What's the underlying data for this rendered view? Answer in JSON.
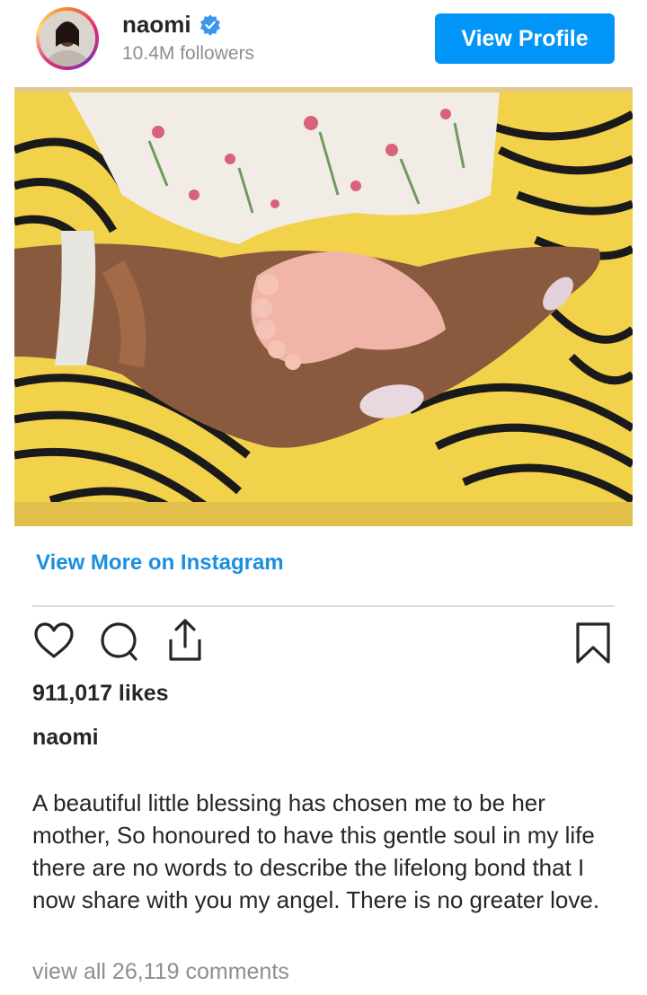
{
  "header": {
    "username": "naomi",
    "followers": "10.4M followers",
    "view_profile_label": "View Profile"
  },
  "post": {
    "image_alt": "Baby feet cradled in a hand over yellow and black patterned fabric",
    "view_more_label": "View More on Instagram",
    "likes": "911,017 likes",
    "author": "naomi",
    "caption": "A beautiful little blessing has chosen me to be her mother, So honoured to have this gentle soul in my life there are no words to describe the lifelong bond that I now share with you my angel. There is no greater love.",
    "comments_link": "view all 26,119 comments"
  },
  "icons": {
    "like": "heart-icon",
    "comment": "comment-bubble-icon",
    "share": "share-icon",
    "save": "bookmark-icon",
    "verified": "verified-badge-icon"
  },
  "colors": {
    "accent": "#0095f6",
    "link": "#1a8fe0",
    "text": "#262626",
    "muted": "#8e8e8e"
  }
}
